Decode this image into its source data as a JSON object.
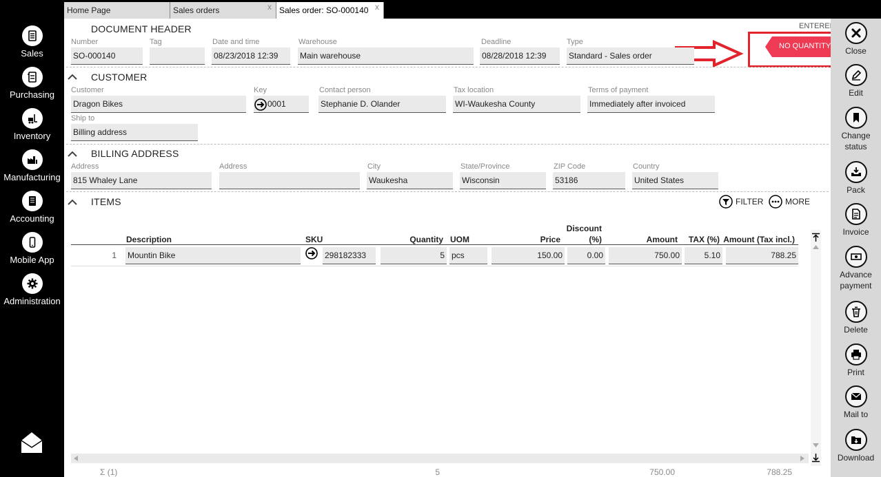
{
  "nav": [
    {
      "label": "Sales",
      "icon": "sales-doc-icon"
    },
    {
      "label": "Purchasing",
      "icon": "purchasing-icon"
    },
    {
      "label": "Inventory",
      "icon": "inventory-forklift-icon"
    },
    {
      "label": "Manufacturing",
      "icon": "factory-icon"
    },
    {
      "label": "Accounting",
      "icon": "ledger-icon"
    },
    {
      "label": "Mobile App",
      "icon": "mobile-phone-icon"
    },
    {
      "label": "Administration",
      "icon": "gear-icon"
    }
  ],
  "tabs": [
    {
      "label": "Home Page"
    },
    {
      "label": "Sales orders"
    },
    {
      "label": "Sales order: SO-000140"
    }
  ],
  "status": {
    "entered": "ENTERED",
    "flag": "NO QUANTITY"
  },
  "header": {
    "title": "DOCUMENT HEADER",
    "number_label": "Number",
    "number": "SO-000140",
    "tag_label": "Tag",
    "tag": "",
    "datetime_label": "Date and time",
    "datetime": "08/23/2018 12:39",
    "warehouse_label": "Warehouse",
    "warehouse": "Main warehouse",
    "deadline_label": "Deadline",
    "deadline": "08/28/2018 12:39",
    "type_label": "Type",
    "type": "Standard - Sales order"
  },
  "customer": {
    "title": "CUSTOMER",
    "customer_label": "Customer",
    "customer": "Dragon Bikes",
    "key_label": "Key",
    "key": "0001",
    "contact_label": "Contact person",
    "contact": "Stephanie D. Olander",
    "tax_label": "Tax location",
    "tax": "WI-Waukesha County",
    "terms_label": "Terms of payment",
    "terms": "Immediately after invoiced",
    "shipto_label": "Ship to",
    "shipto": "Billing address"
  },
  "billing": {
    "title": "BILLING ADDRESS",
    "address_label": "Address",
    "address": "815 Whaley Lane",
    "address2_label": "Address",
    "address2": "",
    "city_label": "City",
    "city": "Waukesha",
    "state_label": "State/Province",
    "state": "Wisconsin",
    "zip_label": "ZIP Code",
    "zip": "53186",
    "country_label": "Country",
    "country": "United States"
  },
  "items": {
    "title": "ITEMS",
    "filter_label": "FILTER",
    "more_label": "MORE",
    "columns": {
      "description": "Description",
      "sku": "SKU",
      "quantity": "Quantity",
      "uom": "UOM",
      "price": "Price",
      "discount_top": "Discount",
      "discount_bottom": "(%)",
      "amount": "Amount",
      "tax": "TAX (%)",
      "amount_tax": "Amount (Tax incl.)"
    },
    "rows": [
      {
        "num": "1",
        "description": "Mountin Bike",
        "sku": "298182333",
        "quantity": "5",
        "uom": "pcs",
        "price": "150.00",
        "discount": "0.00",
        "amount": "750.00",
        "tax": "5.10",
        "amount_tax": "788.25"
      }
    ],
    "totals": {
      "count": "Σ (1)",
      "quantity": "5",
      "amount": "750.00",
      "amount_tax": "788.25"
    }
  },
  "actions": [
    {
      "label": "Close",
      "icon": "close-icon"
    },
    {
      "label": "Edit",
      "icon": "edit-pencil-icon"
    },
    {
      "label": "Change status",
      "icon": "bookmark-icon"
    },
    {
      "label": "Pack",
      "icon": "pack-tray-icon"
    },
    {
      "label": "Invoice",
      "icon": "invoice-doc-icon"
    },
    {
      "label": "Advance payment",
      "icon": "banknote-icon"
    },
    {
      "label": "Delete",
      "icon": "trash-icon"
    },
    {
      "label": "Print",
      "icon": "printer-icon"
    },
    {
      "label": "Mail to",
      "icon": "envelope-icon"
    },
    {
      "label": "Download",
      "icon": "download-folder-icon"
    }
  ],
  "colors": {
    "flag": "#ee3a52",
    "highlight": "#e1242b",
    "sidebar": "#000000",
    "field": "#eaeaea"
  }
}
